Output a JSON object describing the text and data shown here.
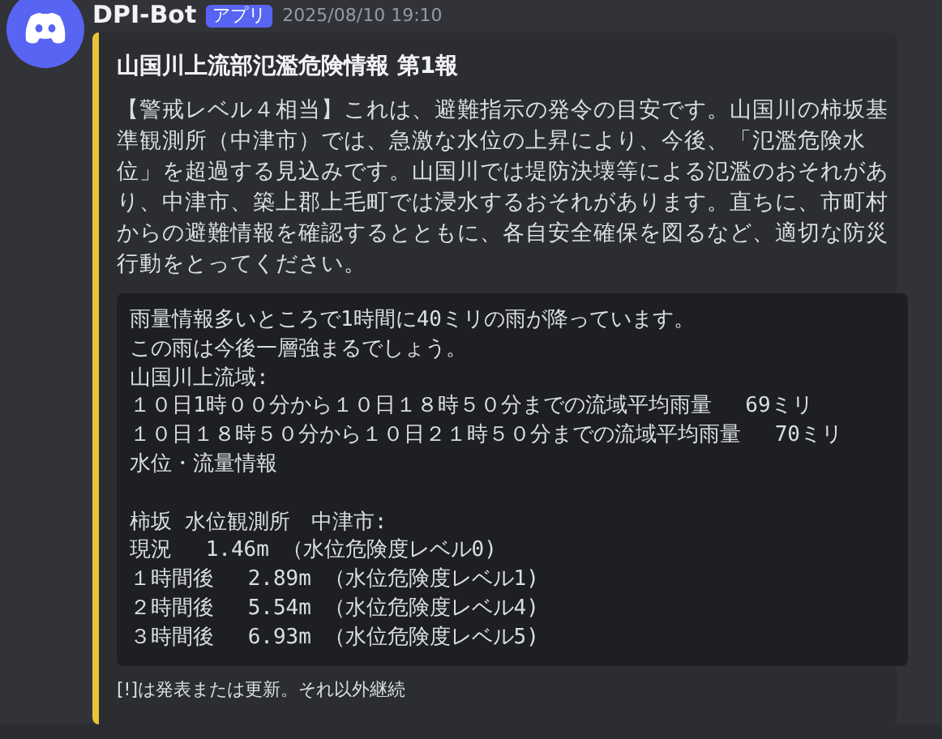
{
  "message": {
    "author": "DPI-Bot",
    "badge": "アプリ",
    "timestamp": "2025/08/10 19:10"
  },
  "embed": {
    "color": "#e6c53a",
    "title": "山国川上流部氾濫危険情報 第1報",
    "description": "【警戒レベル４相当】これは、避難指示の発令の目安です。山国川の柿坂基準観測所（中津市）では、急激な水位の上昇により、今後、「氾濫危険水位」を超過する見込みです。山国川では堤防決壊等による氾濫のおそれがあり、中津市、築上郡上毛町では浸水するおそれがあります。直ちに、市町村からの避難情報を確認するとともに、各自安全確保を図るなど、適切な防災行動をとってください。",
    "code_groups": [
      [
        "雨量情報多いところで1時間に40ミリの雨が降っています。",
        "この雨は今後一層強まるでしょう。",
        "山国川上流域:",
        "１０日1時００分から１０日１８時５０分までの流域平均雨量　 69ミリ",
        "１０日１８時５０分から１０日２１時５０分までの流域平均雨量　 70ミリ",
        "水位・流量情報"
      ],
      [
        "柿坂 水位観測所　中津市:",
        "現況　 1.46m （水位危険度レベル0)",
        "１時間後　 2.89m （水位危険度レベル1)",
        "２時間後　 5.54m （水位危険度レベル4)",
        "３時間後　 6.93m （水位危険度レベル5)"
      ]
    ],
    "footer": "[!]は発表または更新。それ以外継続"
  }
}
